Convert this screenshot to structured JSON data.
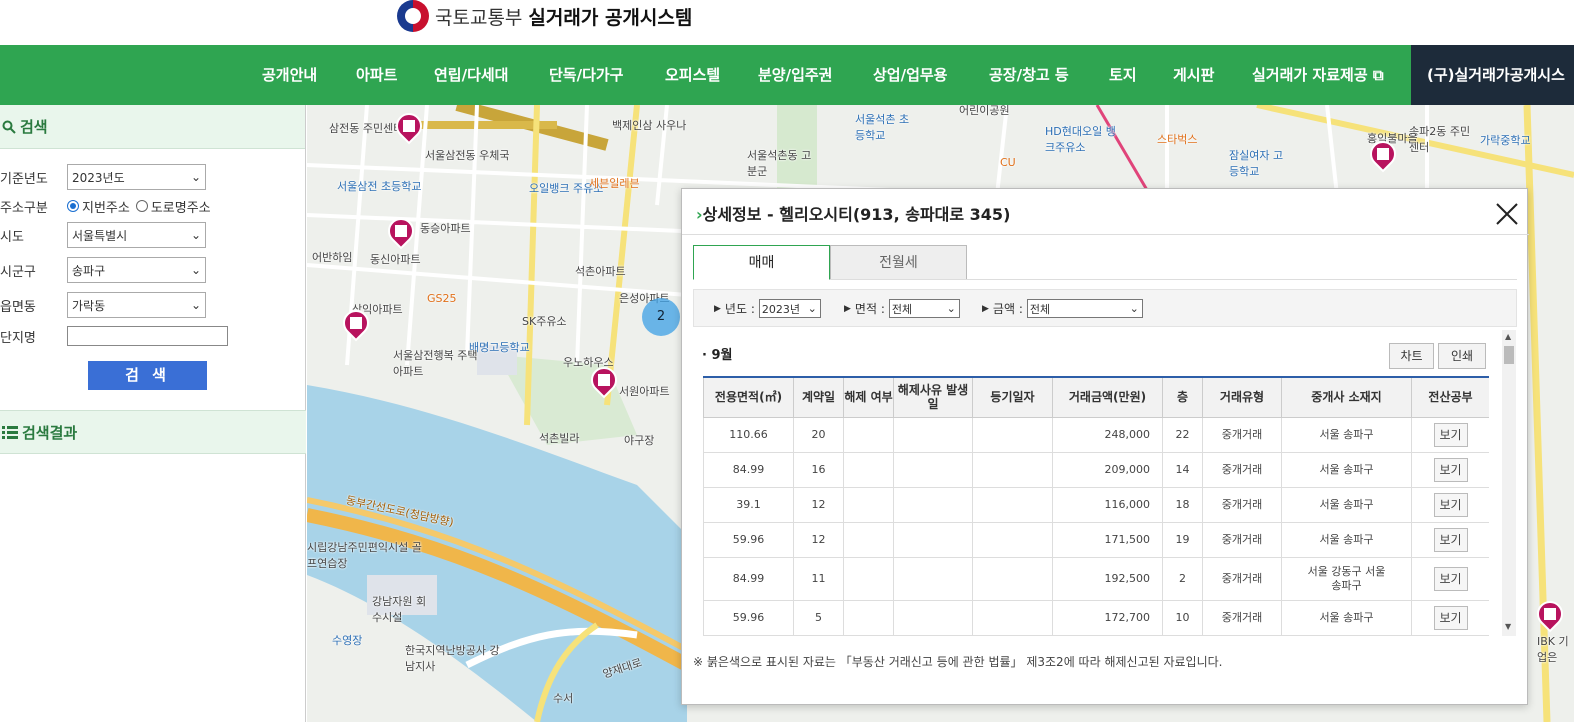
{
  "header": {
    "ministry": "국토교통부",
    "system_title": "실거래가 공개시스템"
  },
  "nav": {
    "items": [
      "공개안내",
      "아파트",
      "연립/다세대",
      "단독/다가구",
      "오피스텔",
      "분양/입주권",
      "상업/업무용",
      "공장/창고 등",
      "토지",
      "게시판",
      "실거래가 자료제공 ⧉"
    ],
    "old_system": "(구)실거래가공개시스"
  },
  "sidebar": {
    "search_title": "검색",
    "year_label": "기준년도",
    "year_value": "2023년도",
    "address_type_label": "주소구분",
    "address_lot": "지번주소",
    "address_road": "도로명주소",
    "city_label": "시도",
    "city_value": "서울특별시",
    "district_label": "시군구",
    "district_value": "송파구",
    "dong_label": "읍면동",
    "dong_value": "가락동",
    "complex_label": "단지명",
    "complex_value": "",
    "search_button": "검 색",
    "results_title": "검색결과"
  },
  "map": {
    "labels": [
      "삼전동 주민센터",
      "서울삼전동 우체국",
      "서울삼전 초등학교",
      "동승아파트",
      "동신아파트",
      "어반하임",
      "삼익아파트",
      "백제인삼 사우나",
      "오일뱅크 주유소",
      "세븐일레븐",
      "석촌아파트",
      "SK주유소",
      "배명고등학교",
      "우노하우스",
      "서원아파트",
      "은성아파트",
      "석촌빌라",
      "야구장",
      "GS25",
      "서울삼전행복 주택아파트",
      "어린이공원",
      "HD현대오일 뱅크주유소",
      "스타벅스",
      "CU",
      "서울석촌 초등학교",
      "서울석촌동 고분군",
      "잠실여자 고등학교",
      "송파2동 주민센터",
      "가락중학교",
      "홍익불마을",
      "IBK 기업은",
      "한국지역난방공사 강남지사",
      "강남자원 회수시설",
      "수영장",
      "시립강남주민편익시설 골프연습장",
      "동부간선도로(청담방향)",
      "양재대로",
      "수서"
    ],
    "cluster_count": "2"
  },
  "modal": {
    "title": "상세정보 - 헬리오시티(913, 송파대로 345)",
    "tabs": {
      "sale": "매매",
      "rent": "전월세"
    },
    "filters": {
      "year_label": "년도 :",
      "year_value": "2023년",
      "area_label": "면적 :",
      "area_value": "전체",
      "amount_label": "금액 :",
      "amount_value": "전체"
    },
    "month": "9월",
    "chart_button": "차트",
    "print_button": "인쇄",
    "columns": [
      "전용면적(㎡)",
      "계약일",
      "해제 여부",
      "해제사유 발생일",
      "등기일자",
      "거래금액(만원)",
      "층",
      "거래유형",
      "중개사 소재지",
      "전산공부"
    ],
    "rows": [
      {
        "area": "110.66",
        "day": "20",
        "cancel": "",
        "cancel_date": "",
        "reg_date": "",
        "price": "248,000",
        "floor": "22",
        "type": "중개거래",
        "agent": "서울 송파구",
        "view": "보기"
      },
      {
        "area": "84.99",
        "day": "16",
        "cancel": "",
        "cancel_date": "",
        "reg_date": "",
        "price": "209,000",
        "floor": "14",
        "type": "중개거래",
        "agent": "서울 송파구",
        "view": "보기"
      },
      {
        "area": "39.1",
        "day": "12",
        "cancel": "",
        "cancel_date": "",
        "reg_date": "",
        "price": "116,000",
        "floor": "18",
        "type": "중개거래",
        "agent": "서울 송파구",
        "view": "보기"
      },
      {
        "area": "59.96",
        "day": "12",
        "cancel": "",
        "cancel_date": "",
        "reg_date": "",
        "price": "171,500",
        "floor": "19",
        "type": "중개거래",
        "agent": "서울 송파구",
        "view": "보기"
      },
      {
        "area": "84.99",
        "day": "11",
        "cancel": "",
        "cancel_date": "",
        "reg_date": "",
        "price": "192,500",
        "floor": "2",
        "type": "중개거래",
        "agent": "서울 강동구 서울 송파구",
        "view": "보기"
      },
      {
        "area": "59.96",
        "day": "5",
        "cancel": "",
        "cancel_date": "",
        "reg_date": "",
        "price": "172,700",
        "floor": "10",
        "type": "중개거래",
        "agent": "서울 송파구",
        "view": "보기"
      }
    ],
    "note": "※ 붉은색으로 표시된 자료는 「부동산 거래신고 등에 관한 법률」 제3조2에 따라 해제신고된 자료입니다."
  },
  "colors": {
    "nav_green": "#2fa551",
    "nav_dark": "#1d2b3a",
    "button_blue": "#3a6fd6",
    "pin_magenta": "#b8135e",
    "table_header_line": "#2d5ea8"
  }
}
